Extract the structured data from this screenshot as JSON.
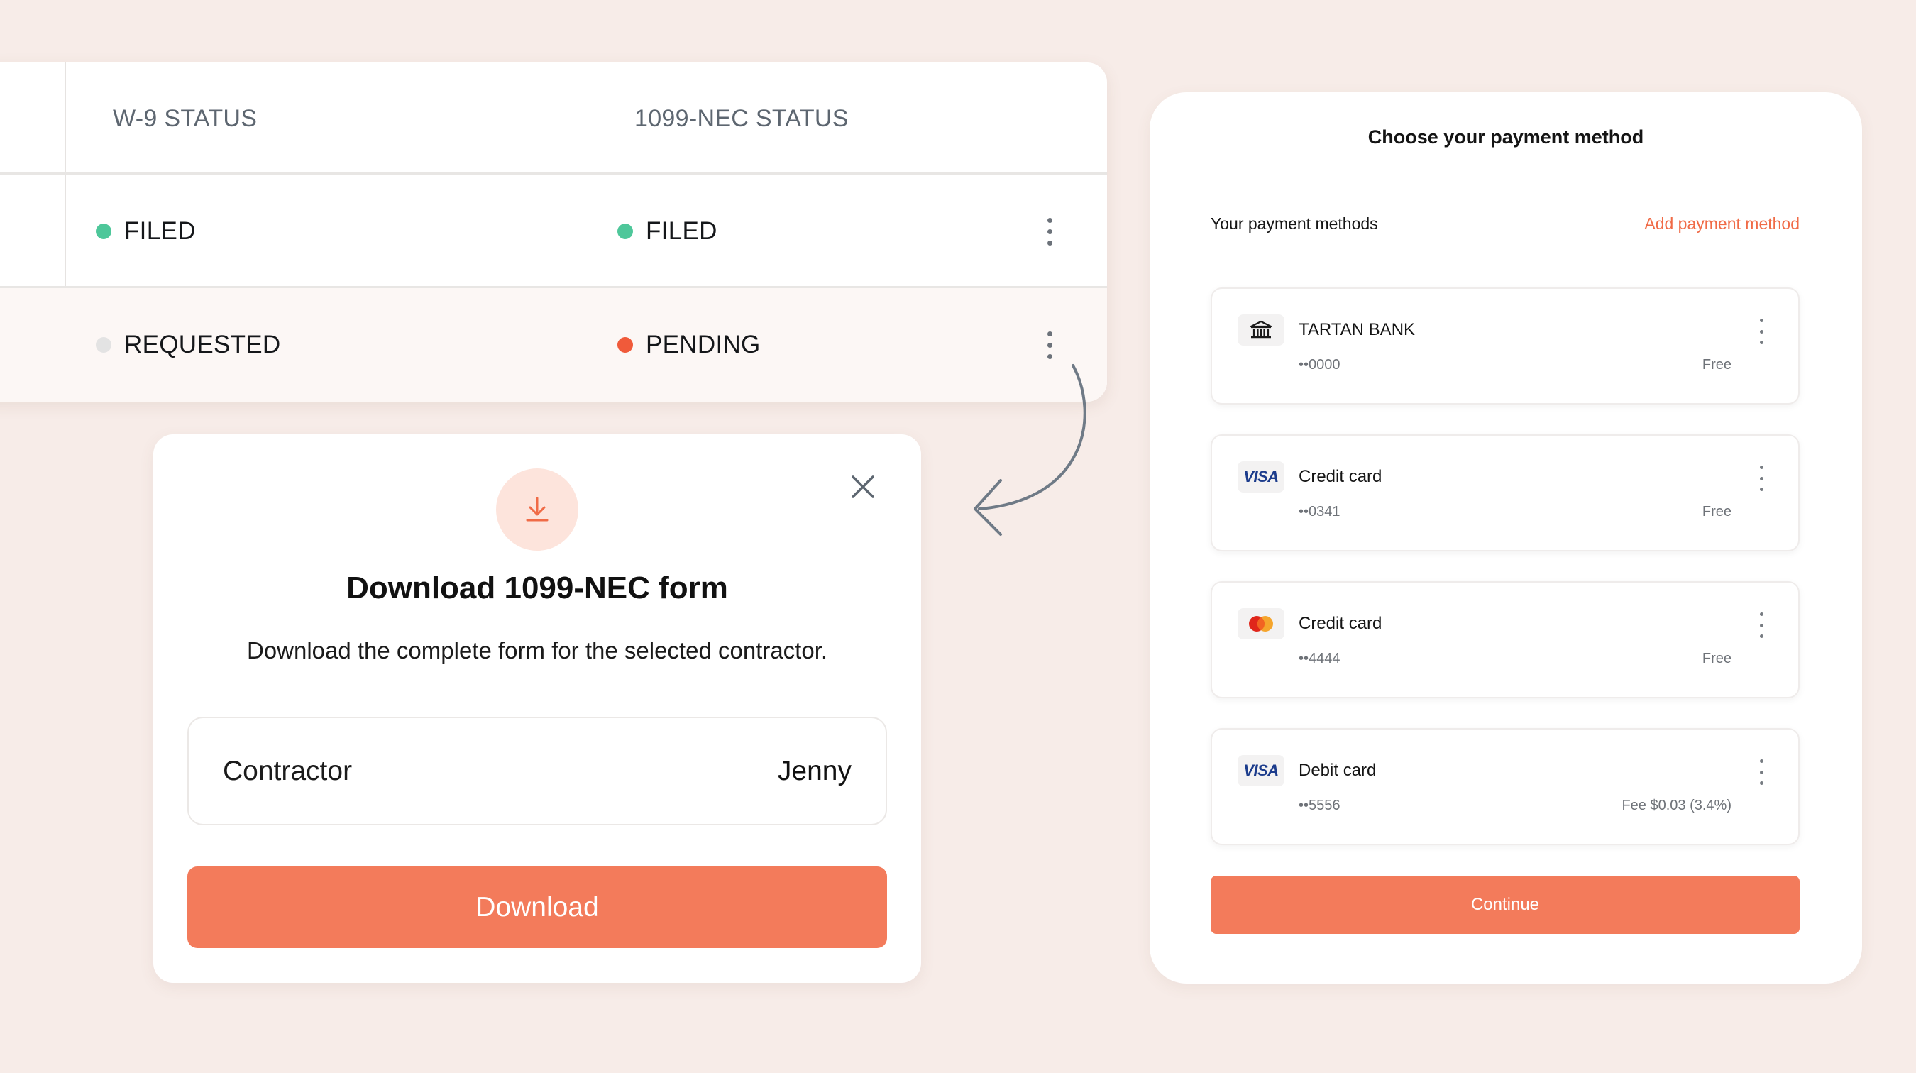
{
  "colors": {
    "background": "#f7ece8",
    "accent": "#f37b5b",
    "status_filed": "#4ec79a",
    "status_requested": "#e3e3e3",
    "status_pending": "#f05a3a"
  },
  "status_table": {
    "columns": [
      "W-9 STATUS",
      "1099-NEC STATUS"
    ],
    "rows": [
      {
        "w9": "FILED",
        "w9_color": "#4ec79a",
        "nec": "FILED",
        "nec_color": "#4ec79a"
      },
      {
        "w9": "REQUESTED",
        "w9_color": "#e3e3e3",
        "nec": "PENDING",
        "nec_color": "#f05a3a"
      }
    ],
    "row_menu_icon": "kebab-menu-icon"
  },
  "download_modal": {
    "icon": "download-icon",
    "close_icon": "close-icon",
    "title": "Download 1099-NEC form",
    "subtitle": "Download the complete form for the selected contractor.",
    "field_label": "Contractor",
    "field_value": "Jenny",
    "button_label": "Download"
  },
  "payment": {
    "title": "Choose your payment method",
    "methods_label": "Your payment methods",
    "add_label": "Add payment method",
    "methods": [
      {
        "brand": "bank",
        "logo_icon": "bank-icon",
        "name": "TARTAN BANK",
        "masked": "••0000",
        "fee": "Free"
      },
      {
        "brand": "VISA",
        "logo_icon": "visa-logo",
        "name": "Credit card",
        "masked": "••0341",
        "fee": "Free"
      },
      {
        "brand": "mastercard",
        "logo_icon": "mastercard-logo",
        "name": "Credit card",
        "masked": "••4444",
        "fee": "Free"
      },
      {
        "brand": "VISA",
        "logo_icon": "visa-logo",
        "name": "Debit card",
        "masked": "••5556",
        "fee": "Fee $0.03 (3.4%)"
      }
    ],
    "continue_label": "Continue"
  }
}
